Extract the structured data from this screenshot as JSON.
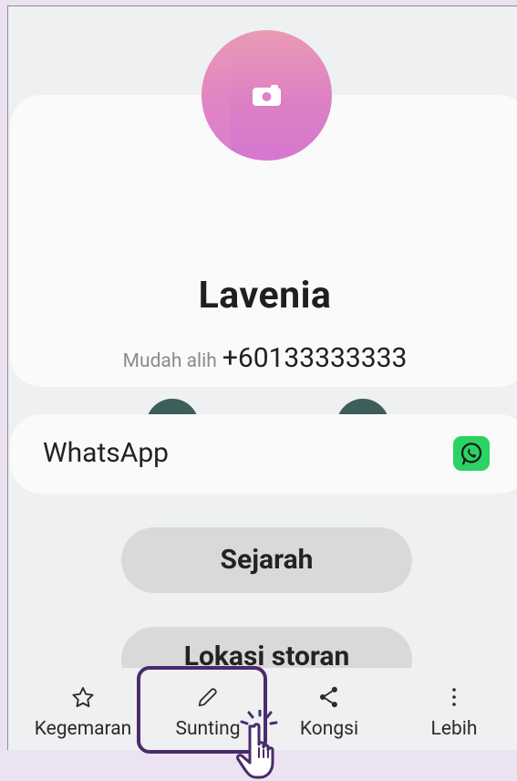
{
  "contact": {
    "name": "Lavenia",
    "phone_type": "Mudah alih",
    "phone_number": "+60133333333"
  },
  "actions": {
    "call_icon": "phone-icon",
    "message_icon": "chat-bubble-icon"
  },
  "apps": {
    "whatsapp_label": "WhatsApp",
    "whatsapp_icon": "whatsapp-icon"
  },
  "buttons": {
    "history": "Sejarah",
    "storage_location": "Lokasi storan"
  },
  "bottom_nav": {
    "items": [
      {
        "label": "Kegemaran",
        "icon": "star-icon"
      },
      {
        "label": "Sunting",
        "icon": "pencil-icon"
      },
      {
        "label": "Kongsi",
        "icon": "share-icon"
      },
      {
        "label": "Lebih",
        "icon": "more-vertical-icon"
      }
    ]
  },
  "colors": {
    "action_button": "#3d5e5a",
    "whatsapp_green": "#2bd365",
    "highlight_border": "#4a2b6b",
    "avatar_gradient_top": "#ea9bb2",
    "avatar_gradient_bottom": "#da7ed0"
  }
}
